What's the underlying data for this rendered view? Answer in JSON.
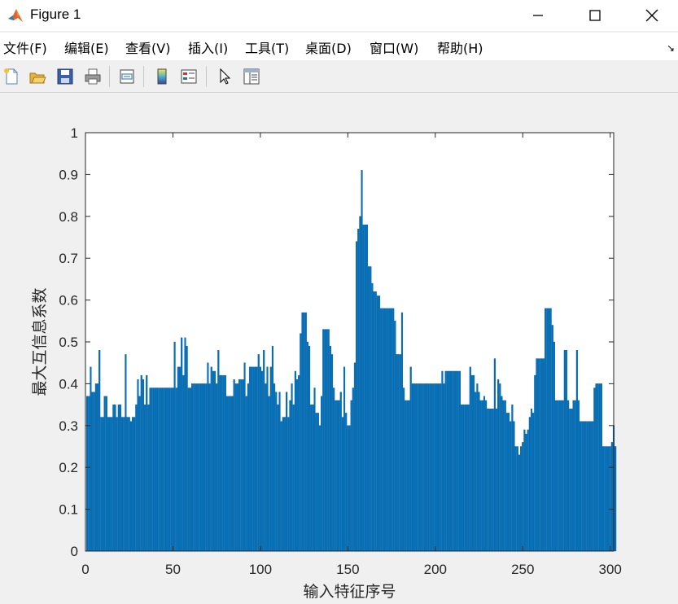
{
  "window": {
    "title": "Figure 1",
    "controls": {
      "minimize": "minimize-icon",
      "maximize": "maximize-icon",
      "close": "close-icon"
    }
  },
  "menu": [
    "文件(F)",
    "编辑(E)",
    "查看(V)",
    "插入(I)",
    "工具(T)",
    "桌面(D)",
    "窗口(W)",
    "帮助(H)"
  ],
  "toolbar": [
    "new-figure-icon",
    "open-file-icon",
    "save-icon",
    "print-icon",
    "link-plot-icon",
    "colorbar-icon",
    "legend-icon",
    "pointer-icon",
    "property-editor-icon"
  ],
  "colors": {
    "bar": "#0072BD",
    "plot_bg": "#ffffff",
    "axis": "#262626"
  },
  "chart_data": {
    "type": "bar",
    "xlabel": "输入特征序号",
    "ylabel": "最大互信息系数",
    "xlim": [
      0,
      302
    ],
    "ylim": [
      0,
      1
    ],
    "xticks": [
      0,
      50,
      100,
      150,
      200,
      250,
      300
    ],
    "yticks": [
      0,
      0.1,
      0.2,
      0.3,
      0.4,
      0.5,
      0.6,
      0.7,
      0.8,
      0.9,
      1
    ],
    "ytick_labels": [
      "0",
      "0.1",
      "0.2",
      "0.3",
      "0.4",
      "0.5",
      "0.6",
      "0.7",
      "0.8",
      "0.9",
      "1"
    ],
    "x_start": 1,
    "values": [
      0.37,
      0.37,
      0.44,
      0.38,
      0.38,
      0.4,
      0.4,
      0.48,
      0.32,
      0.32,
      0.37,
      0.37,
      0.32,
      0.32,
      0.32,
      0.35,
      0.35,
      0.32,
      0.35,
      0.35,
      0.32,
      0.32,
      0.47,
      0.32,
      0.32,
      0.31,
      0.32,
      0.32,
      0.35,
      0.41,
      0.37,
      0.42,
      0.41,
      0.35,
      0.42,
      0.35,
      0.39,
      0.39,
      0.39,
      0.39,
      0.39,
      0.39,
      0.39,
      0.39,
      0.39,
      0.39,
      0.39,
      0.39,
      0.39,
      0.39,
      0.5,
      0.39,
      0.44,
      0.44,
      0.51,
      0.42,
      0.51,
      0.49,
      0.39,
      0.39,
      0.4,
      0.4,
      0.4,
      0.4,
      0.4,
      0.4,
      0.4,
      0.4,
      0.4,
      0.45,
      0.4,
      0.44,
      0.43,
      0.43,
      0.4,
      0.48,
      0.42,
      0.42,
      0.42,
      0.42,
      0.37,
      0.37,
      0.37,
      0.37,
      0.41,
      0.4,
      0.4,
      0.41,
      0.41,
      0.41,
      0.45,
      0.37,
      0.4,
      0.44,
      0.44,
      0.44,
      0.44,
      0.44,
      0.47,
      0.44,
      0.43,
      0.48,
      0.4,
      0.44,
      0.37,
      0.44,
      0.49,
      0.4,
      0.38,
      0.35,
      0.38,
      0.31,
      0.32,
      0.32,
      0.38,
      0.32,
      0.36,
      0.4,
      0.35,
      0.43,
      0.41,
      0.42,
      0.52,
      0.57,
      0.57,
      0.57,
      0.5,
      0.49,
      0.35,
      0.35,
      0.39,
      0.33,
      0.33,
      0.3,
      0.37,
      0.53,
      0.53,
      0.53,
      0.53,
      0.49,
      0.47,
      0.39,
      0.36,
      0.36,
      0.36,
      0.38,
      0.32,
      0.44,
      0.33,
      0.3,
      0.3,
      0.36,
      0.39,
      0.45,
      0.74,
      0.77,
      0.8,
      0.91,
      0.78,
      0.78,
      0.78,
      0.68,
      0.68,
      0.64,
      0.62,
      0.62,
      0.61,
      0.61,
      0.58,
      0.58,
      0.58,
      0.58,
      0.58,
      0.58,
      0.58,
      0.58,
      0.55,
      0.47,
      0.47,
      0.47,
      0.57,
      0.39,
      0.36,
      0.36,
      0.36,
      0.44,
      0.4,
      0.4,
      0.4,
      0.4,
      0.4,
      0.4,
      0.4,
      0.4,
      0.4,
      0.4,
      0.4,
      0.4,
      0.4,
      0.4,
      0.4,
      0.4,
      0.4,
      0.43,
      0.4,
      0.43,
      0.43,
      0.43,
      0.43,
      0.43,
      0.43,
      0.43,
      0.43,
      0.43,
      0.35,
      0.35,
      0.35,
      0.35,
      0.35,
      0.44,
      0.42,
      0.42,
      0.38,
      0.4,
      0.38,
      0.36,
      0.36,
      0.37,
      0.36,
      0.34,
      0.34,
      0.34,
      0.34,
      0.46,
      0.34,
      0.41,
      0.4,
      0.37,
      0.36,
      0.36,
      0.33,
      0.33,
      0.31,
      0.35,
      0.31,
      0.25,
      0.25,
      0.23,
      0.25,
      0.26,
      0.29,
      0.28,
      0.29,
      0.32,
      0.34,
      0.33,
      0.42,
      0.46,
      0.46,
      0.46,
      0.46,
      0.46,
      0.58,
      0.58,
      0.58,
      0.58,
      0.54,
      0.5,
      0.36,
      0.36,
      0.36,
      0.36,
      0.36,
      0.48,
      0.48,
      0.36,
      0.34,
      0.34,
      0.36,
      0.36,
      0.48,
      0.36,
      0.31,
      0.31,
      0.31,
      0.31,
      0.31,
      0.31,
      0.31,
      0.31,
      0.39,
      0.4,
      0.4,
      0.4,
      0.4,
      0.25,
      0.25,
      0.25,
      0.25,
      0.25,
      0.26,
      0.3,
      0.25
    ]
  }
}
